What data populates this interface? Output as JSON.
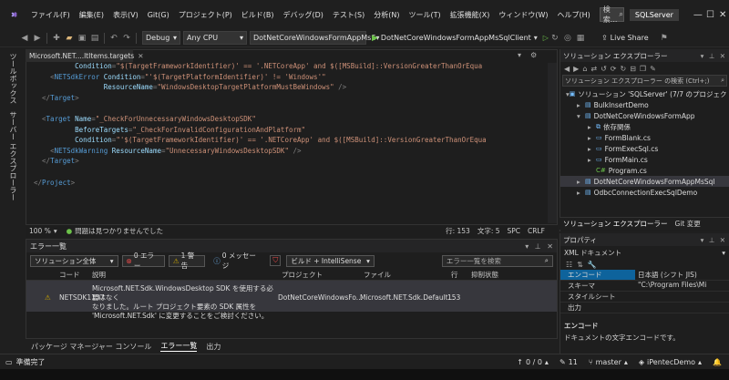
{
  "menu": {
    "file": "ファイル(F)",
    "edit": "編集(E)",
    "view": "表示(V)",
    "git": "Git(G)",
    "project": "プロジェクト(P)",
    "build": "ビルド(B)",
    "debug": "デバッグ(D)",
    "test": "テスト(S)",
    "analyze": "分析(N)",
    "tools": "ツール(T)",
    "extensions": "拡張機能(X)",
    "window": "ウィンドウ(W)",
    "help": "ヘルプ(H)",
    "search": "検索...",
    "solution": "SQLServer"
  },
  "toolbar": {
    "config": "Debug",
    "platform": "Any CPU",
    "project": "DotNetCoreWindowsFormAppMsS",
    "run_target": "DotNetCoreWindowsFormAppMsSqlClient",
    "live_share": "Live Share"
  },
  "left_strip": {
    "toolbox": "ツールボックス",
    "server_explorer": "サーバー エクスプローラー"
  },
  "editor": {
    "tab_label": "Microsoft.NET....ltItems.targets",
    "lines": [
      {
        "indent": "          ",
        "segments": [
          [
            "attr",
            "Condition"
          ],
          [
            "punc",
            "="
          ],
          [
            "str",
            "\"$(TargetFrameworkIdentifier)' == '.NETCoreApp' and $([MSBuild]::VersionGreaterThanOrEqua"
          ]
        ]
      },
      {
        "indent": "    ",
        "segments": [
          [
            "punc",
            "<"
          ],
          [
            "tag",
            "NETSdkError"
          ],
          [
            "attr",
            " Condition"
          ],
          [
            "punc",
            "="
          ],
          [
            "str",
            "\"'$(TargetPlatformIdentifier)' != 'Windows'\""
          ]
        ]
      },
      {
        "indent": "                 ",
        "segments": [
          [
            "attr",
            "ResourceName"
          ],
          [
            "punc",
            "="
          ],
          [
            "str",
            "\"WindowsDesktopTargetPlatformMustBeWindows\""
          ],
          [
            "punc",
            " />"
          ]
        ]
      },
      {
        "indent": "  ",
        "segments": [
          [
            "punc",
            "</"
          ],
          [
            "tag",
            "Target"
          ],
          [
            "punc",
            ">"
          ]
        ]
      },
      {
        "indent": "",
        "segments": []
      },
      {
        "indent": "  ",
        "segments": [
          [
            "punc",
            "<"
          ],
          [
            "tag",
            "Target"
          ],
          [
            "attr",
            " Name"
          ],
          [
            "punc",
            "="
          ],
          [
            "str",
            "\"_CheckForUnnecessaryWindowsDesktopSDK\""
          ]
        ]
      },
      {
        "indent": "          ",
        "segments": [
          [
            "attr",
            "BeforeTargets"
          ],
          [
            "punc",
            "="
          ],
          [
            "str",
            "\"_CheckForInvalidConfigurationAndPlatform\""
          ]
        ]
      },
      {
        "indent": "          ",
        "segments": [
          [
            "attr",
            "Condition"
          ],
          [
            "punc",
            "="
          ],
          [
            "str",
            "\"'$(TargetFrameworkIdentifier)' == '.NETCoreApp' and $([MSBuild]::VersionGreaterThanOrEqua"
          ]
        ]
      },
      {
        "indent": "    ",
        "segments": [
          [
            "punc",
            "<"
          ],
          [
            "tag",
            "NETSdkWarning"
          ],
          [
            "attr",
            " ResourceName"
          ],
          [
            "punc",
            "="
          ],
          [
            "str",
            "\"UnnecessaryWindowsDesktopSDK\""
          ],
          [
            "punc",
            " />"
          ]
        ]
      },
      {
        "indent": "  ",
        "segments": [
          [
            "punc",
            "</"
          ],
          [
            "tag",
            "Target"
          ],
          [
            "punc",
            ">"
          ]
        ]
      },
      {
        "indent": "",
        "segments": []
      },
      {
        "indent": "",
        "segments": [
          [
            "punc",
            "</"
          ],
          [
            "tag",
            "Project"
          ],
          [
            "punc",
            ">"
          ]
        ]
      }
    ],
    "zoom": "100 %",
    "issues": "問題は見つかりませんでした",
    "line": "行: 153",
    "char": "文字: 5",
    "spc": "SPC",
    "crlf": "CRLF"
  },
  "error_list": {
    "title": "エラー一覧",
    "scope": "ソリューション全体",
    "errors": "0 エラー",
    "warnings": "1 警告",
    "messages": "0 メッセージ",
    "build_filter": "ビルド + IntelliSense",
    "search_placeholder": "エラー一覧を検索",
    "headers": {
      "code": "コード",
      "description": "説明",
      "project": "プロジェクト",
      "file": "ファイル",
      "line": "行",
      "suppression": "抑制状態"
    },
    "rows": [
      {
        "code": "NETSDK1137",
        "desc1": "Microsoft.NET.Sdk.WindowsDesktop SDK を使用する必要はなく",
        "desc2": "なりました。ルート プロジェクト要素の SDK 属性を",
        "desc3": "'Microsoft.NET.Sdk' に変更することをご検討ください。",
        "project": "DotNetCoreWindowsFo...",
        "file": "Microsoft.NET.Sdk.Default...",
        "line": "153"
      }
    ]
  },
  "bottom_tabs": {
    "pkg": "パッケージ マネージャー コンソール",
    "errors": "エラー一覧",
    "output": "出力"
  },
  "solution_explorer": {
    "title": "ソリューション エクスプローラー",
    "search_placeholder": "ソリューション エクスプローラー の検索 (Ctrl+;)",
    "items": [
      {
        "label": "ソリューション 'SQLServer' (7/7 のプロジェクト)",
        "level": 0
      },
      {
        "label": "BulkInsertDemo",
        "level": 1
      },
      {
        "label": "DotNetCoreWindowsFormApp",
        "level": 1
      },
      {
        "label": "依存関係",
        "level": 2
      },
      {
        "label": "FormBlank.cs",
        "level": 2
      },
      {
        "label": "FormExecSql.cs",
        "level": 2
      },
      {
        "label": "FormMain.cs",
        "level": 2
      },
      {
        "label": "Program.cs",
        "level": 2
      },
      {
        "label": "DotNetCoreWindowsFormAppMsSql",
        "level": 1
      },
      {
        "label": "OdbcConnectionExecSqlDemo",
        "level": 1
      }
    ],
    "tab1": "ソリューション エクスプローラー",
    "tab2": "Git 変更"
  },
  "properties": {
    "title": "プロパティ",
    "object": "XML ドキュメント",
    "rows": [
      {
        "name": "エンコード",
        "value": "日本語 (シフト JIS)"
      },
      {
        "name": "スキーマ",
        "value": "\"C:\\Program Files\\Mi"
      },
      {
        "name": "スタイルシート",
        "value": ""
      },
      {
        "name": "出力",
        "value": ""
      }
    ],
    "desc_title": "エンコード",
    "desc_text": "ドキュメントの文字エンコードです。"
  },
  "statusbar": {
    "ready": "準備完了",
    "updown": "0 / 0",
    "edits": "11",
    "branch": "master",
    "repo": "iPentecDemo"
  }
}
